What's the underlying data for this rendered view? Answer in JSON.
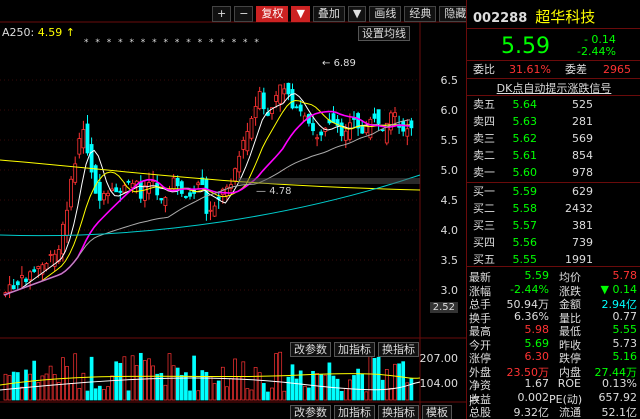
{
  "toolbar": {
    "buttons": [
      "+",
      "−",
      "复权",
      "▼",
      "叠加",
      "▼",
      "画线",
      "经典",
      "隐藏",
      "|||"
    ]
  },
  "chart": {
    "ma_label": "A250:",
    "ma_value": "4.59",
    "ma_arrow": "↑",
    "setting_label": "设置均线",
    "star_row": "* * * * * * * * * * * * * * * *",
    "high_label": "6.89",
    "ma_mark": "4.78",
    "axis_values": [
      "6.5",
      "6.0",
      "5.5",
      "5.0",
      "4.5",
      "4.0",
      "3.5",
      "3.0"
    ],
    "axis_tag": "2.52",
    "vol_tabs": [
      "改参数",
      "加指标",
      "换指标"
    ],
    "vol_axis": [
      "207.00",
      "104.00"
    ],
    "vol_tabs_bottom": [
      "改参数",
      "加指标",
      "换指标",
      "模板"
    ]
  },
  "panel": {
    "code": "002288",
    "name": "超华科技",
    "price": "5.59",
    "change": "- 0.14",
    "change_pct": "-2.44%",
    "ratio_label": "委比",
    "ratio_value": "31.61%",
    "diff_label": "委差",
    "diff_value": "2965",
    "dk_title": "DK点自动提示涨跌信号",
    "sells": [
      {
        "label": "卖五",
        "price": "5.64",
        "vol": "525"
      },
      {
        "label": "卖四",
        "price": "5.63",
        "vol": "281"
      },
      {
        "label": "卖三",
        "price": "5.62",
        "vol": "569"
      },
      {
        "label": "卖二",
        "price": "5.61",
        "vol": "854"
      },
      {
        "label": "卖一",
        "price": "5.60",
        "vol": "978"
      }
    ],
    "buys": [
      {
        "label": "买一",
        "price": "5.59",
        "vol": "629"
      },
      {
        "label": "买二",
        "price": "5.58",
        "vol": "2432"
      },
      {
        "label": "买三",
        "price": "5.57",
        "vol": "381"
      },
      {
        "label": "买四",
        "price": "5.56",
        "vol": "739"
      },
      {
        "label": "买五",
        "price": "5.55",
        "vol": "1991"
      }
    ],
    "stats": [
      {
        "k": "最新",
        "v": "5.59",
        "vc": "green",
        "k2": "均价",
        "v2": "5.78",
        "v2c": "red"
      },
      {
        "k": "涨幅",
        "v": "-2.44%",
        "vc": "green",
        "k2": "涨跌",
        "v2": "▼ 0.14",
        "v2c": "green"
      },
      {
        "k": "总手",
        "v": "50.94万",
        "vc": "white",
        "k2": "金额",
        "v2": "2.94亿",
        "v2c": "cyan"
      },
      {
        "k": "换手",
        "v": "6.36%",
        "vc": "white",
        "k2": "量比",
        "v2": "0.77",
        "v2c": "white"
      },
      {
        "k": "最高",
        "v": "5.98",
        "vc": "red",
        "k2": "最低",
        "v2": "5.55",
        "v2c": "green"
      },
      {
        "k": "今开",
        "v": "5.69",
        "vc": "green",
        "k2": "昨收",
        "v2": "5.73",
        "v2c": "white"
      },
      {
        "k": "涨停",
        "v": "6.30",
        "vc": "red",
        "k2": "跌停",
        "v2": "5.16",
        "v2c": "green"
      },
      {
        "k": "外盘",
        "v": "23.50万",
        "vc": "red",
        "k2": "内盘",
        "v2": "27.44万",
        "v2c": "green"
      },
      {
        "k": "净资产",
        "v": "1.67",
        "vc": "white",
        "k2": "ROE",
        "v2": "0.13%",
        "v2c": "white"
      },
      {
        "k": "收益",
        "v": "0.002",
        "vc": "white",
        "k2": "PE(动)",
        "v2": "657.92",
        "v2c": "white"
      },
      {
        "k": "总股本",
        "v": "9.32亿",
        "vc": "white",
        "k2": "流通",
        "v2": "52.1亿",
        "v2c": "white"
      }
    ]
  }
}
